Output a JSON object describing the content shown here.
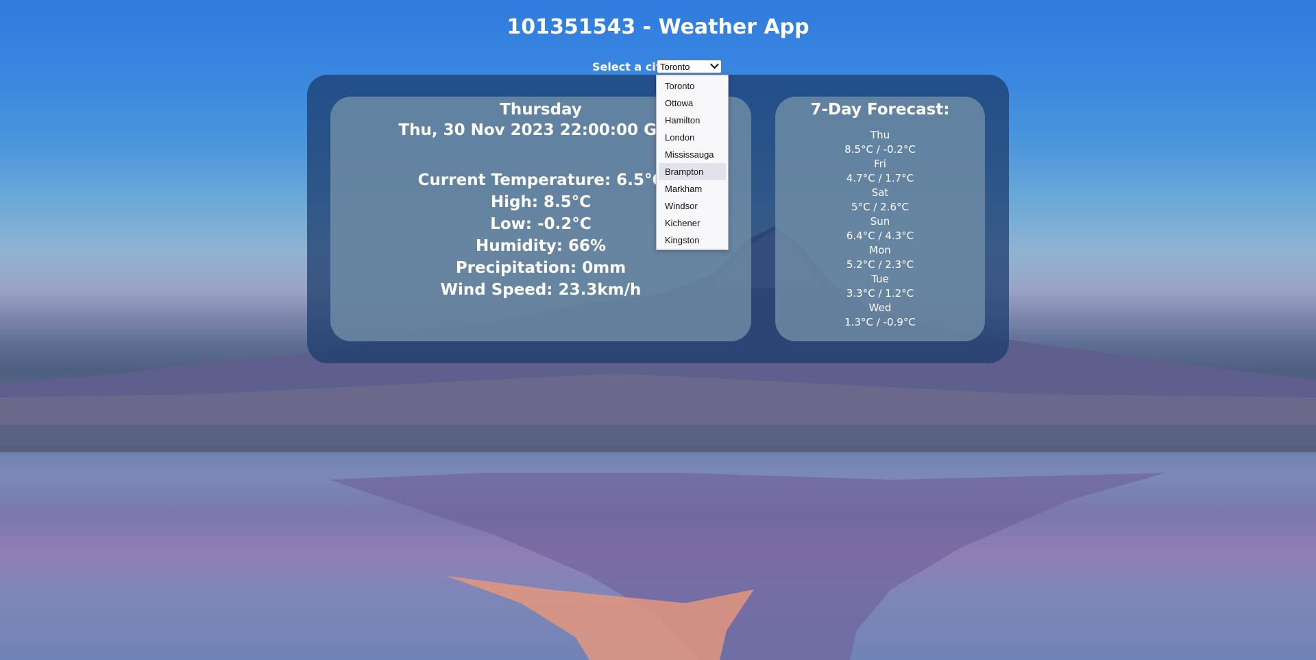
{
  "page": {
    "title": "101351543 - Weather App"
  },
  "city_select": {
    "label": "Select a city:",
    "selected": "Toronto",
    "options": [
      "Toronto",
      "Ottowa",
      "Hamilton",
      "London",
      "Mississauga",
      "Brampton",
      "Markham",
      "Windsor",
      "Kichener",
      "Kingston"
    ],
    "hovered": "Brampton"
  },
  "current": {
    "day": "Thursday",
    "date": "Thu, 30 Nov 2023 22:00:00 GMT",
    "temperature": "Current Temperature: 6.5°C",
    "high": "High: 8.5°C",
    "low": "Low: -0.2°C",
    "humidity": "Humidity: 66%",
    "precipitation": "Precipitation: 0mm",
    "wind": "Wind Speed: 23.3km/h"
  },
  "forecast": {
    "title": "7-Day Forecast:",
    "days": [
      {
        "day": "Thu",
        "temps": "8.5°C / -0.2°C"
      },
      {
        "day": "Fri",
        "temps": "4.7°C / 1.7°C"
      },
      {
        "day": "Sat",
        "temps": "5°C / 2.6°C"
      },
      {
        "day": "Sun",
        "temps": "6.4°C / 4.3°C"
      },
      {
        "day": "Mon",
        "temps": "5.2°C / 2.3°C"
      },
      {
        "day": "Tue",
        "temps": "3.3°C / 1.2°C"
      },
      {
        "day": "Wed",
        "temps": "1.3°C / -0.9°C"
      }
    ]
  }
}
